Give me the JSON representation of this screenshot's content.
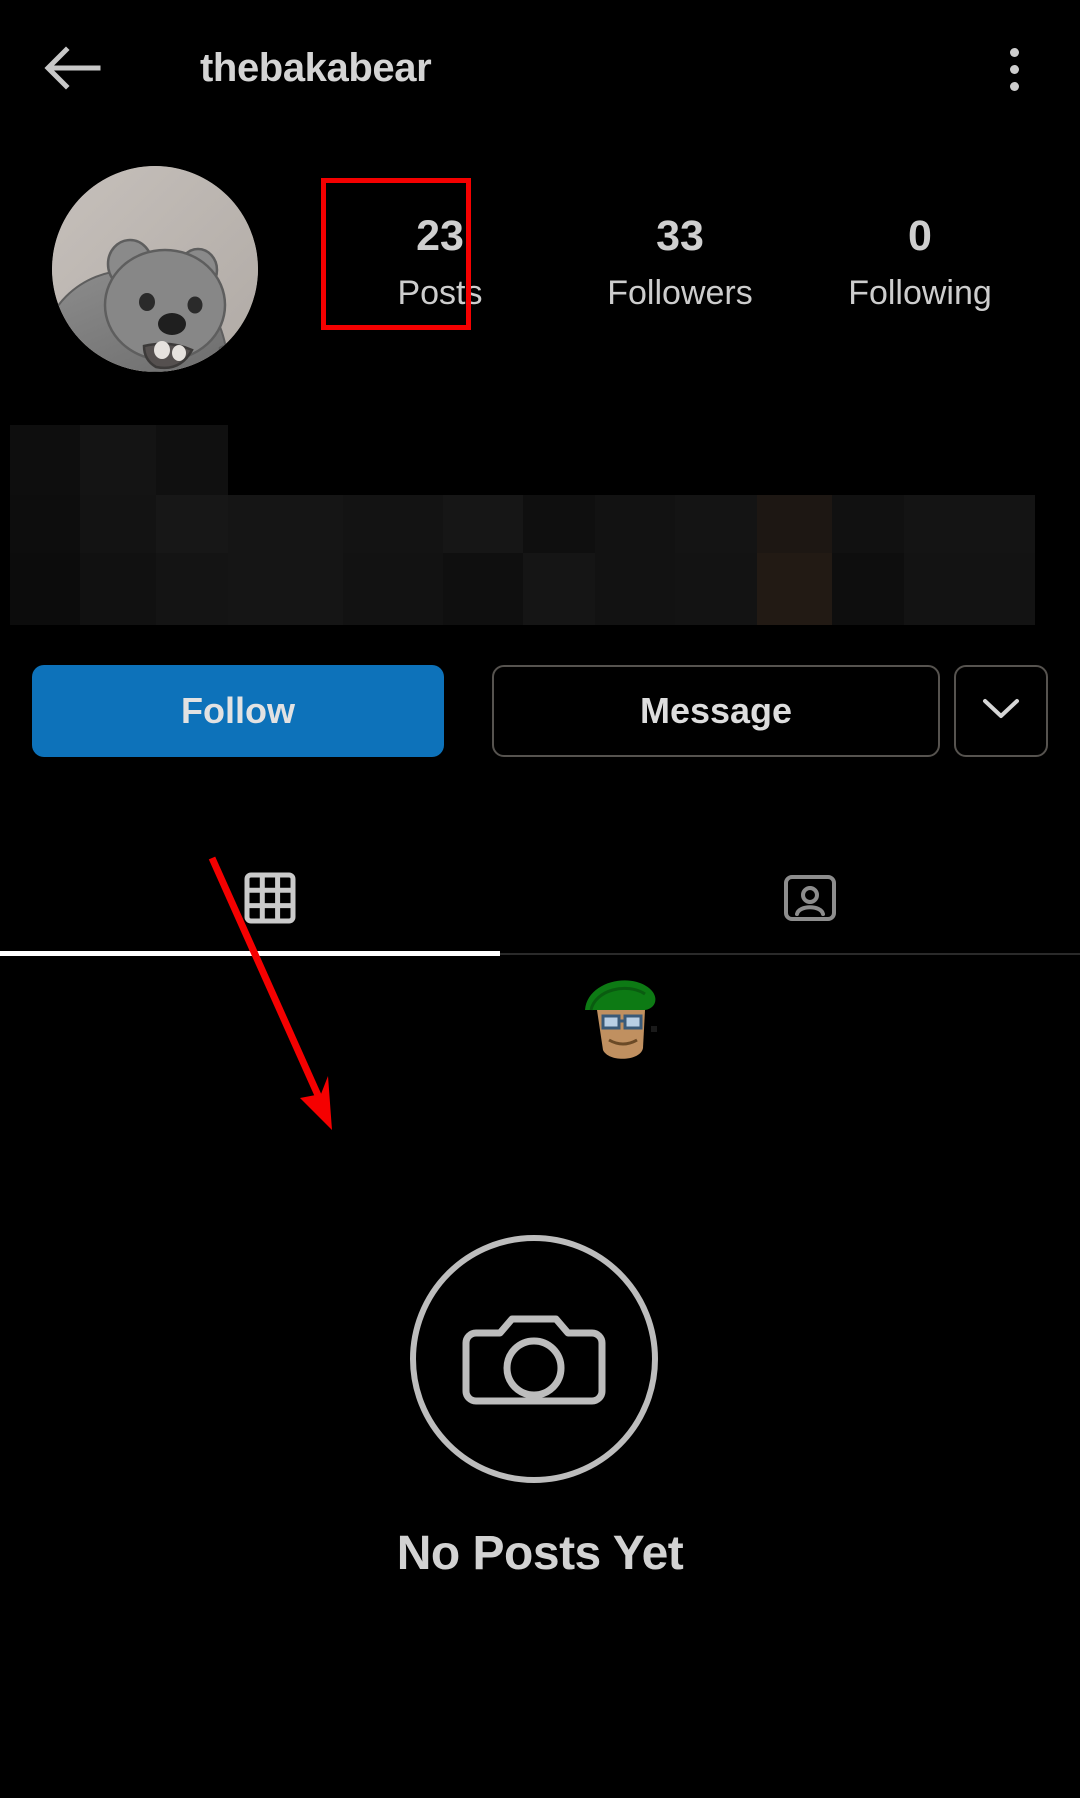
{
  "app": {
    "name": "Instagram",
    "theme": "dark",
    "background_color": "#000000"
  },
  "header": {
    "back_icon": "back-arrow-icon",
    "username": "thebakabear",
    "menu_icon": "three-dot-menu-icon"
  },
  "profile": {
    "avatar_alt": "bear-avatar",
    "stats": [
      {
        "value": "23",
        "label": "Posts",
        "highlighted": true
      },
      {
        "value": "33",
        "label": "Followers",
        "highlighted": false
      },
      {
        "value": "0",
        "label": "Following",
        "highlighted": false
      }
    ],
    "bio_state": "blurred"
  },
  "actions": {
    "follow_label": "Follow",
    "follow_color": "#0d72ba",
    "message_label": "Message",
    "more_icon": "chevron-down-icon"
  },
  "tabs": [
    {
      "icon": "grid-icon",
      "name": "posts-grid-tab",
      "active": true
    },
    {
      "icon": "tagged-person-icon",
      "name": "tagged-tab",
      "active": false
    }
  ],
  "empty_state": {
    "icon": "camera-icon",
    "title": "No Posts Yet"
  },
  "annotations": {
    "highlight_color": "#f50000",
    "box_target": "Posts stat",
    "arrow_color": "#f50000",
    "arrow_points_to": "feed empty area"
  }
}
